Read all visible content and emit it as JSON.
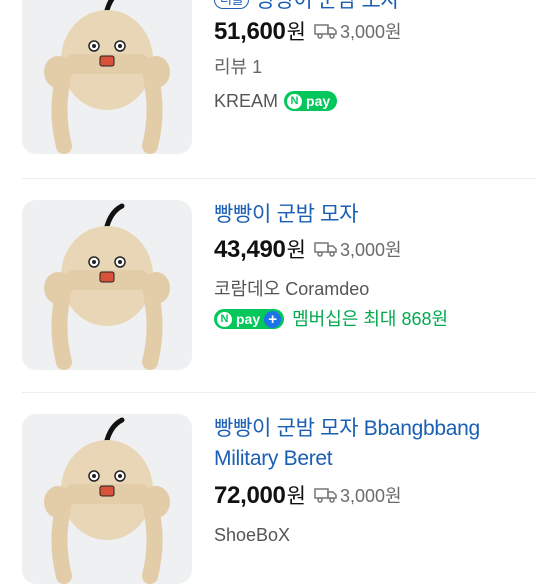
{
  "items": [
    {
      "tag": "더블",
      "title": "빵빵이 군밤 모자",
      "price": "51,600",
      "won": "원",
      "shipping": "3,000원",
      "review": "리뷰 1",
      "seller": "KREAM",
      "npay_label": "pay"
    },
    {
      "title": "빵빵이 군밤 모자",
      "price": "43,490",
      "won": "원",
      "shipping": "3,000원",
      "seller": "코람데오 Coramdeo",
      "npay_label": "pay",
      "benefit": "멤버십은 최대 868원"
    },
    {
      "title": "빵빵이 군밤 모자 Bbangbbang Military Beret",
      "price": "72,000",
      "won": "원",
      "shipping": "3,000원",
      "seller": "ShoeBoX"
    }
  ],
  "colors": {
    "title": "#1a5fb4",
    "npay": "#03c75a",
    "benefit": "#03a94e"
  },
  "icons": [
    "shipping-truck-icon",
    "npay-n-icon",
    "npay-plus-icon"
  ]
}
